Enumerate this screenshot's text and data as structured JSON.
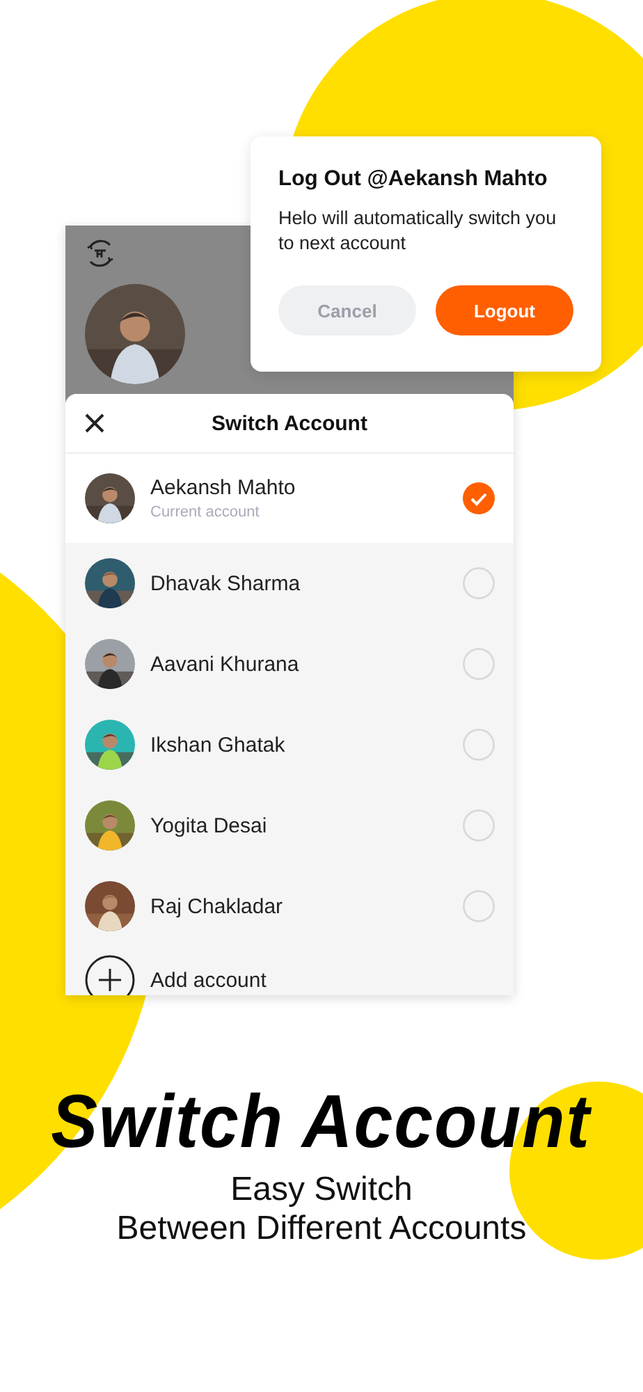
{
  "phone_screen": {
    "sheet": {
      "title": "Switch Account",
      "accounts": [
        {
          "name": "Aekansh Mahto",
          "subtitle": "Current account",
          "selected": true
        },
        {
          "name": "Dhavak Sharma",
          "selected": false
        },
        {
          "name": "Aavani Khurana",
          "selected": false
        },
        {
          "name": "Ikshan Ghatak",
          "selected": false
        },
        {
          "name": "Yogita Desai",
          "selected": false
        },
        {
          "name": "Raj Chakladar",
          "selected": false
        }
      ],
      "add_account": "Add account"
    }
  },
  "dialog": {
    "title": "Log Out @Aekansh Mahto",
    "message": "Helo will automatically switch you to next account",
    "buttons": [
      {
        "label": "Cancel",
        "kind": "secondary"
      },
      {
        "label": "Logout",
        "kind": "primary"
      }
    ]
  },
  "headline": "Switch Account",
  "subtitle_lines": [
    "Easy Switch",
    "Between Different Accounts"
  ]
}
